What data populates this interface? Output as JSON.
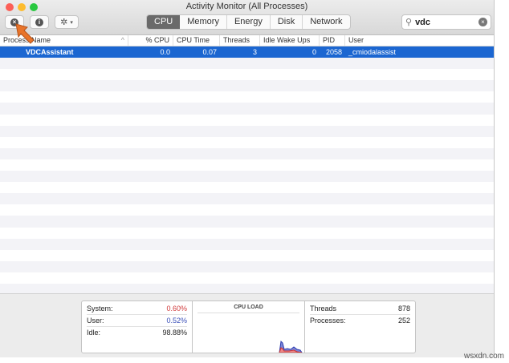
{
  "window": {
    "title": "Activity Monitor (All Processes)"
  },
  "toolbar": {
    "tabs": [
      "CPU",
      "Memory",
      "Energy",
      "Disk",
      "Network"
    ],
    "active_tab": "CPU",
    "search_value": "vdc"
  },
  "table": {
    "columns": [
      "Process Name",
      "% CPU",
      "CPU Time",
      "Threads",
      "Idle Wake Ups",
      "PID",
      "User"
    ],
    "rows": [
      {
        "name": "VDCAssistant",
        "cpu": "0.0",
        "cpu_time": "0.07",
        "threads": "3",
        "idle_wake_ups": "0",
        "pid": "2058",
        "user": "_cmiodalassist"
      }
    ]
  },
  "footer": {
    "system_label": "System:",
    "system_value": "0.60%",
    "user_label": "User:",
    "user_value": "0.52%",
    "idle_label": "Idle:",
    "idle_value": "98.88%",
    "chart_title": "CPU LOAD",
    "threads_label": "Threads",
    "threads_value": "878",
    "processes_label": "Processes:",
    "processes_value": "252"
  },
  "colors": {
    "system": "#d0393a",
    "user": "#3a4fb8",
    "selection": "#1b66d1"
  },
  "watermark": "wsxdn.com"
}
